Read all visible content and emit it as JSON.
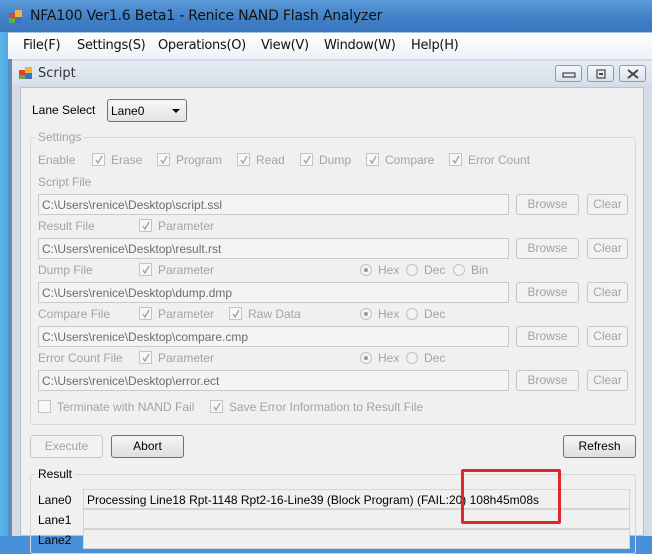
{
  "window": {
    "title": "NFA100 Ver1.6 Beta1 - Renice NAND Flash Analyzer",
    "icon": "app-icon"
  },
  "menu": {
    "items": [
      "File(F)",
      "Settings(S)",
      "Operations(O)",
      "View(V)",
      "Window(W)",
      "Help(H)"
    ]
  },
  "child_window": {
    "title": "Script",
    "icon": "script-window-icon",
    "controls": [
      "minimize-icon",
      "restore-icon",
      "close-icon"
    ]
  },
  "lane_select": {
    "label": "Lane Select",
    "value": "Lane0"
  },
  "settings": {
    "group_label": "Settings",
    "enable_label": "Enable",
    "enable_options": [
      {
        "label": "Erase",
        "checked": true
      },
      {
        "label": "Program",
        "checked": true
      },
      {
        "label": "Read",
        "checked": true
      },
      {
        "label": "Dump",
        "checked": true
      },
      {
        "label": "Compare",
        "checked": true
      },
      {
        "label": "Error Count",
        "checked": true
      }
    ],
    "script_file": {
      "label": "Script File",
      "path": "C:\\Users\\renice\\Desktop\\script.ssl"
    },
    "result_file": {
      "label": "Result File",
      "parameter_label": "Parameter",
      "parameter_checked": true,
      "path": "C:\\Users\\renice\\Desktop\\result.rst"
    },
    "dump_file": {
      "label": "Dump File",
      "parameter_label": "Parameter",
      "parameter_checked": true,
      "format_options": [
        "Hex",
        "Dec",
        "Bin"
      ],
      "format_selected": "Hex",
      "path": "C:\\Users\\renice\\Desktop\\dump.dmp"
    },
    "compare_file": {
      "label": "Compare File",
      "parameter_label": "Parameter",
      "parameter_checked": true,
      "raw_data_label": "Raw Data",
      "raw_data_checked": true,
      "format_options": [
        "Hex",
        "Dec"
      ],
      "format_selected": "Hex",
      "path": "C:\\Users\\renice\\Desktop\\compare.cmp"
    },
    "error_count_file": {
      "label": "Error Count File",
      "parameter_label": "Parameter",
      "parameter_checked": true,
      "format_options": [
        "Hex",
        "Dec"
      ],
      "format_selected": "Hex",
      "path": "C:\\Users\\renice\\Desktop\\error.ect"
    },
    "browse_label": "Browse",
    "clear_label": "Clear",
    "terminate_label": "Terminate with NAND Fail",
    "terminate_checked": false,
    "save_error_label": "Save Error Information to Result File",
    "save_error_checked": true
  },
  "actions": {
    "execute_label": "Execute",
    "abort_label": "Abort",
    "refresh_label": "Refresh"
  },
  "result": {
    "group_label": "Result",
    "lanes": [
      {
        "label": "Lane0",
        "status": "Processing Line18 Rpt-1148 Rpt2-16-Line39 (Block Program) (FAIL:20) 108h45m08s"
      },
      {
        "label": "Lane1",
        "status": ""
      },
      {
        "label": "Lane2",
        "status": ""
      }
    ]
  },
  "colors": {
    "title_bar": "#3f7fc6",
    "highlight_box": "#e0282a",
    "disabled_text": "#a3a3a3"
  }
}
